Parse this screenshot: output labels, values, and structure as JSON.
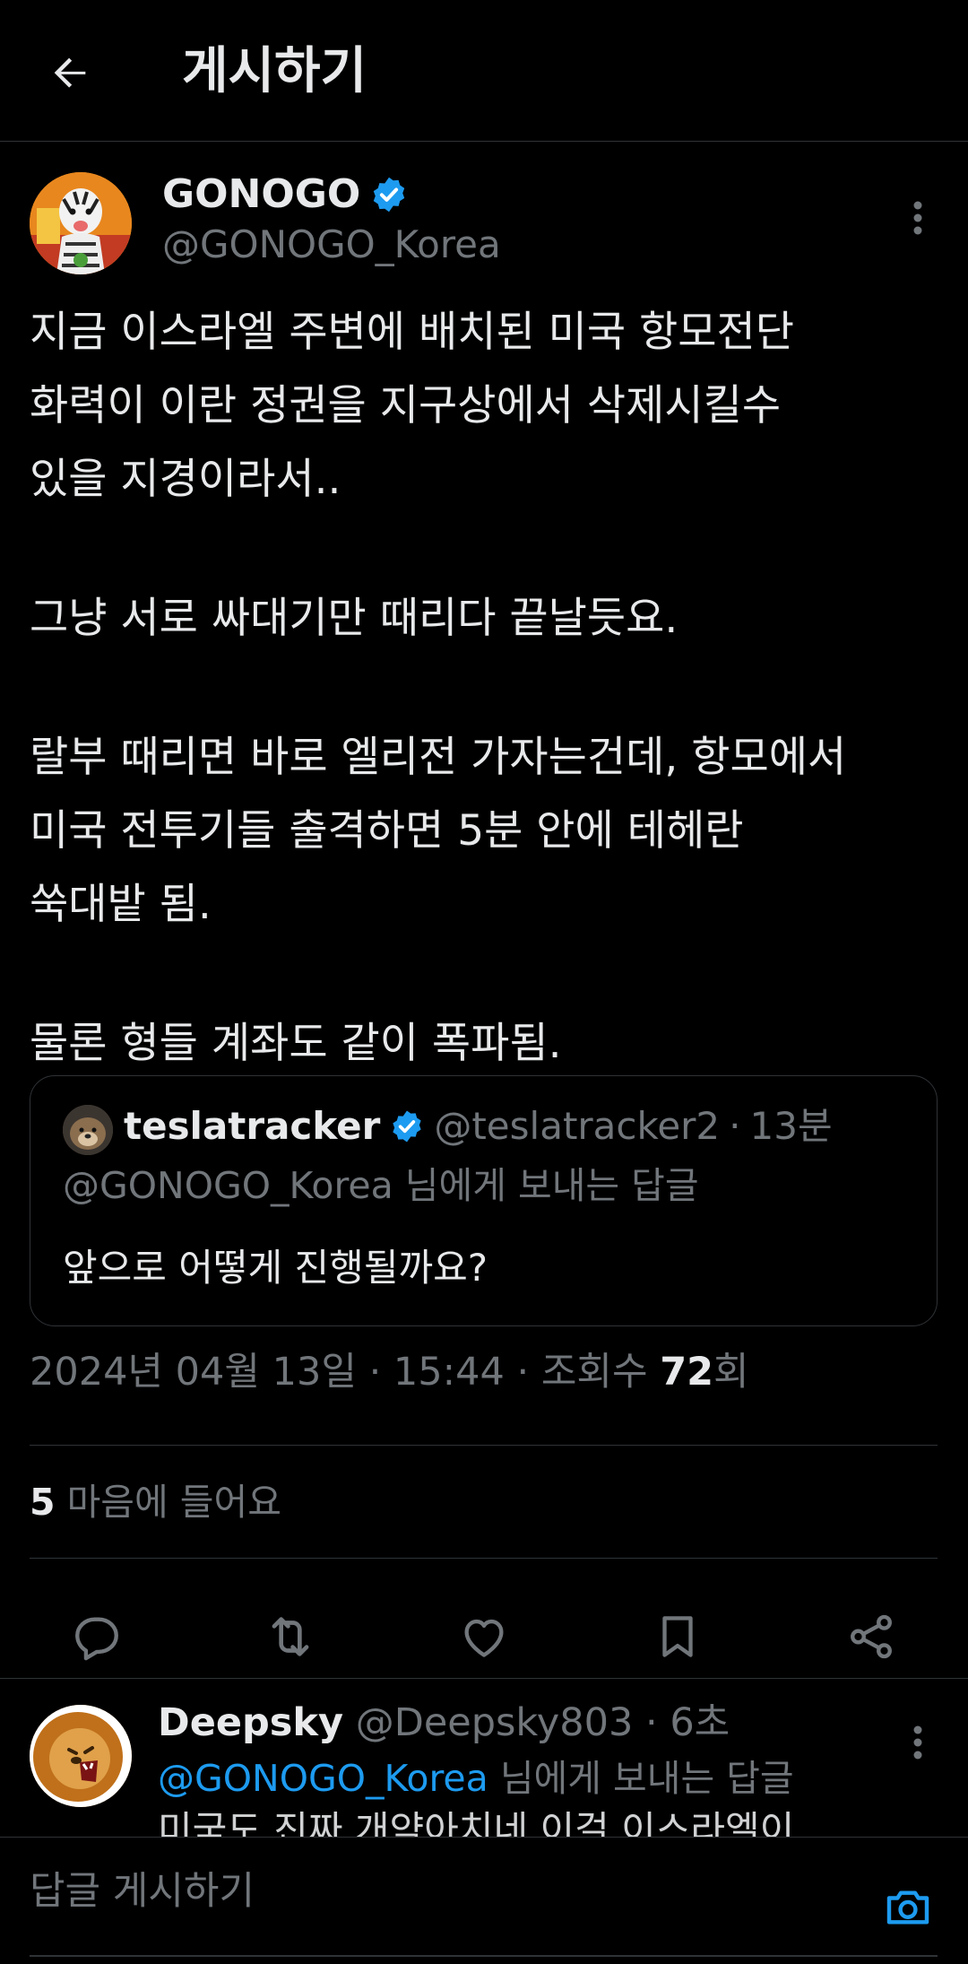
{
  "header": {
    "title": "게시하기",
    "back_icon": "arrow-left-icon"
  },
  "tweet": {
    "author_name": "GONOGO",
    "author_handle": "@GONOGO_Korea",
    "verified": true,
    "paragraphs": [
      "지금 이스라엘 주변에 배치된 미국 항모전단\n화력이 이란 정권을 지구상에서 삭제시킬수\n있을 지경이라서..",
      "그냥 서로 싸대기만 때리다 끝날듯요.",
      "랄부 때리면 바로 엘리전 가자는건데, 항모에서\n미국 전투기들 출격하면 5분 안에 테헤란\n쑥대밭 됨.",
      "물론 형들 계좌도 같이 폭파됨."
    ],
    "quote": {
      "author_name": "teslatracker",
      "author_handle": "@teslatracker2",
      "time": "13분",
      "separator": "·",
      "reply_to": "@GONOGO_Korea 님에게 보내는 답글",
      "text": "앞으로 어떻게 진행될까요?"
    },
    "date": "2024년 04월 13일",
    "time": "15:44",
    "views_label": "조회수",
    "views_count": "72",
    "views_suffix": "회",
    "separator": "·",
    "likes_count": "5",
    "likes_label": "마음에 들어요"
  },
  "actions": [
    {
      "name": "reply-icon"
    },
    {
      "name": "retweet-icon"
    },
    {
      "name": "like-icon"
    },
    {
      "name": "bookmark-icon"
    },
    {
      "name": "share-icon"
    }
  ],
  "reply": {
    "author_name": "Deepsky",
    "author_handle": "@Deepsky803",
    "time": "6초",
    "separator": "·",
    "mention": "@GONOGO_Korea",
    "reply_suffix": "님에게 보내는 답글",
    "text": "미국도 진짜 개약아치네 이걸 이스라엘이"
  },
  "composer": {
    "placeholder": "답글 게시하기"
  },
  "colors": {
    "background": "#000000",
    "text": "#e7e9ea",
    "secondary": "#71767b",
    "accent": "#1d9bf0",
    "border": "#2f3336"
  }
}
